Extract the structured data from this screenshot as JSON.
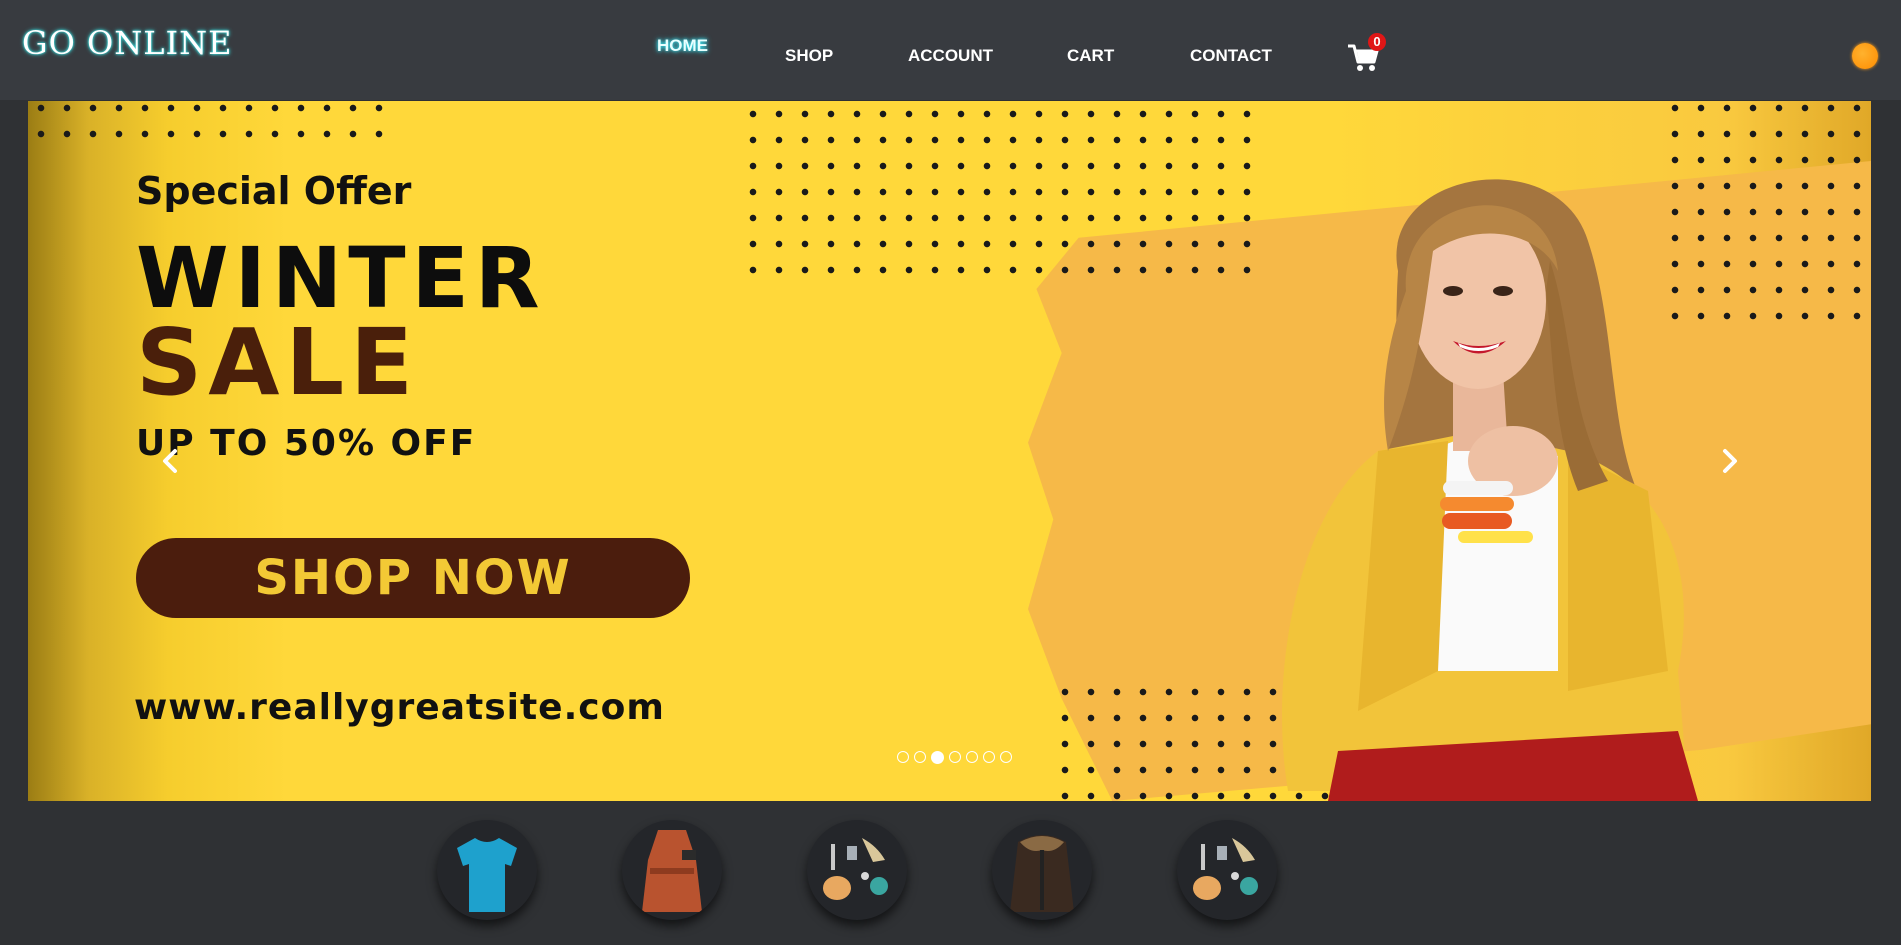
{
  "header": {
    "logo": "GO ONLINE",
    "nav": [
      {
        "label": "HOME",
        "active": true
      },
      {
        "label": "SHOP"
      },
      {
        "label": "ACCOUNT"
      },
      {
        "label": "CART"
      },
      {
        "label": "CONTACT"
      }
    ],
    "cart_icon": "shopping-cart-icon",
    "cart_count": "0",
    "theme_toggle_icon": "sun-icon"
  },
  "hero": {
    "special_offer": "Special Offer",
    "headline_1": "WINTER",
    "headline_2": "SALE",
    "discount": "UP TO 50% OFF",
    "cta": "SHOP NOW",
    "url": "www.reallygreatsite.com",
    "prev_icon": "chevron-left-icon",
    "next_icon": "chevron-right-icon",
    "slide_count": 7,
    "active_slide": 3,
    "colors": {
      "background": "#ffd83a",
      "cta_background": "#4b1d0d",
      "cta_text": "#f3c935",
      "sale_text": "#4a1f0b"
    }
  },
  "thumbnails": [
    {
      "item": "blue t-shirt"
    },
    {
      "item": "rust trench coat"
    },
    {
      "item": "accessories flat lay"
    },
    {
      "item": "fur jacket"
    },
    {
      "item": "accessories flat lay"
    }
  ],
  "colors": {
    "navbar": "#383b40",
    "page_background": "#2f3134",
    "nav_active_glow": "#37e3f2",
    "badge": "#e01616"
  }
}
